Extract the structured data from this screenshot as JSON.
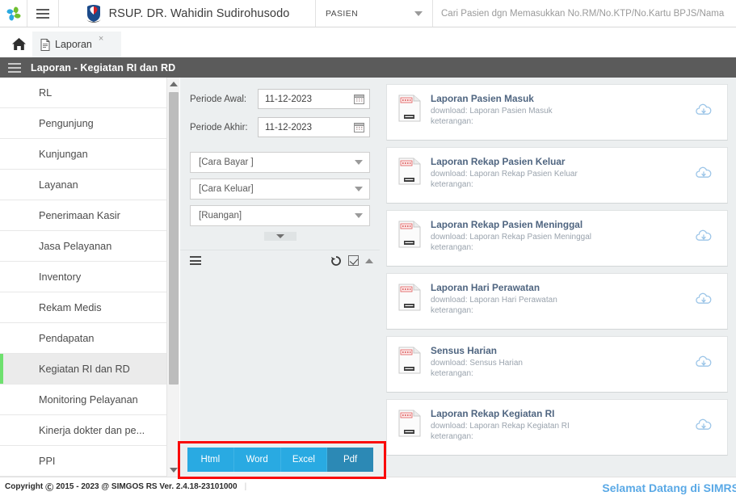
{
  "header": {
    "logo_icon": "simgos-pinwheel-logo",
    "menu_icon": "hamburger-menu-icon",
    "hospital_logo_icon": "hospital-shield-logo",
    "hospital_name": "RSUP. DR. Wahidin Sudirohusodo",
    "search_scope_label": "PASIEN",
    "search_scope_caret_icon": "chevron-down-icon",
    "search_placeholder": "Cari Pasien dgn Memasukkan No.RM/No.KTP/No.Kartu BPJS/Nama"
  },
  "tabs": {
    "home_icon": "home-icon",
    "items": [
      {
        "icon": "document-icon",
        "label": "Laporan",
        "close": "×"
      }
    ]
  },
  "page_title": {
    "menu_icon": "hamburger-menu-icon",
    "text": "Laporan - Kegiatan RI dan RD"
  },
  "sidebar": {
    "items": [
      {
        "label": "RL",
        "active": false
      },
      {
        "label": "Pengunjung",
        "active": false
      },
      {
        "label": "Kunjungan",
        "active": false
      },
      {
        "label": "Layanan",
        "active": false
      },
      {
        "label": "Penerimaan Kasir",
        "active": false
      },
      {
        "label": "Jasa Pelayanan",
        "active": false
      },
      {
        "label": "Inventory",
        "active": false
      },
      {
        "label": "Rekam Medis",
        "active": false
      },
      {
        "label": "Pendapatan",
        "active": false
      },
      {
        "label": "Kegiatan RI dan RD",
        "active": true
      },
      {
        "label": "Monitoring Pelayanan",
        "active": false
      },
      {
        "label": "Kinerja dokter dan pe...",
        "active": false
      },
      {
        "label": "PPI",
        "active": false
      }
    ],
    "scroll_up_icon": "scroll-up-arrow-icon",
    "scroll_down_icon": "scroll-down-arrow-icon"
  },
  "filter_form": {
    "periode_awal_label": "Periode Awal:",
    "periode_awal_value": "11-12-2023",
    "periode_akhir_label": "Periode Akhir:",
    "periode_akhir_value": "11-12-2023",
    "calendar_icon": "calendar-icon",
    "selects": [
      {
        "value": "[Cara Bayar ]",
        "icon": "chevron-down-icon"
      },
      {
        "value": "[Cara Keluar]",
        "icon": "chevron-down-icon"
      },
      {
        "value": "[Ruangan]",
        "icon": "chevron-down-icon"
      }
    ],
    "expander_icon": "chevron-down-icon",
    "toolbar": {
      "list_icon": "list-icon",
      "history_icon": "history-restore-icon",
      "checkbox_icon": "checkbox-checked-icon",
      "collapse_icon": "chevron-up-icon"
    }
  },
  "reports": {
    "download_prefix": "download: ",
    "keterangan_label": "keterangan:",
    "file_icon": "report-file-icon",
    "download_icon": "cloud-download-icon",
    "items": [
      {
        "title": "Laporan Pasien Masuk",
        "download": "download: Laporan Pasien Masuk",
        "keterangan": "keterangan:"
      },
      {
        "title": "Laporan Rekap Pasien Keluar",
        "download": "download: Laporan Rekap Pasien Keluar",
        "keterangan": "keterangan:"
      },
      {
        "title": "Laporan Rekap Pasien Meninggal",
        "download": "download: Laporan Rekap Pasien Meninggal",
        "keterangan": "keterangan:"
      },
      {
        "title": "Laporan Hari Perawatan",
        "download": "download: Laporan Hari Perawatan",
        "keterangan": "keterangan:"
      },
      {
        "title": "Sensus Harian",
        "download": "download: Sensus Harian",
        "keterangan": "keterangan:"
      },
      {
        "title": "Laporan Rekap Kegiatan RI",
        "download": "download: Laporan Rekap Kegiatan RI",
        "keterangan": "keterangan:"
      }
    ]
  },
  "export_bar": {
    "buttons": [
      {
        "label": "Html",
        "selected": false
      },
      {
        "label": "Word",
        "selected": false
      },
      {
        "label": "Excel",
        "selected": false
      },
      {
        "label": "Pdf",
        "selected": true
      }
    ],
    "highlight_color": "#fa0a0a",
    "button_color": "#29aae2",
    "selected_color": "#2c89b5"
  },
  "footer": {
    "copyright": "Copyright",
    "copyright_symbol": "Ⓒ",
    "copyright_text": "2015 - 2023 @ SIMGOS RS Ver. 2.4.18-23101000",
    "welcome": "Selamat Datang di SIMRS",
    "welcome_color": "#5aa9e6"
  }
}
